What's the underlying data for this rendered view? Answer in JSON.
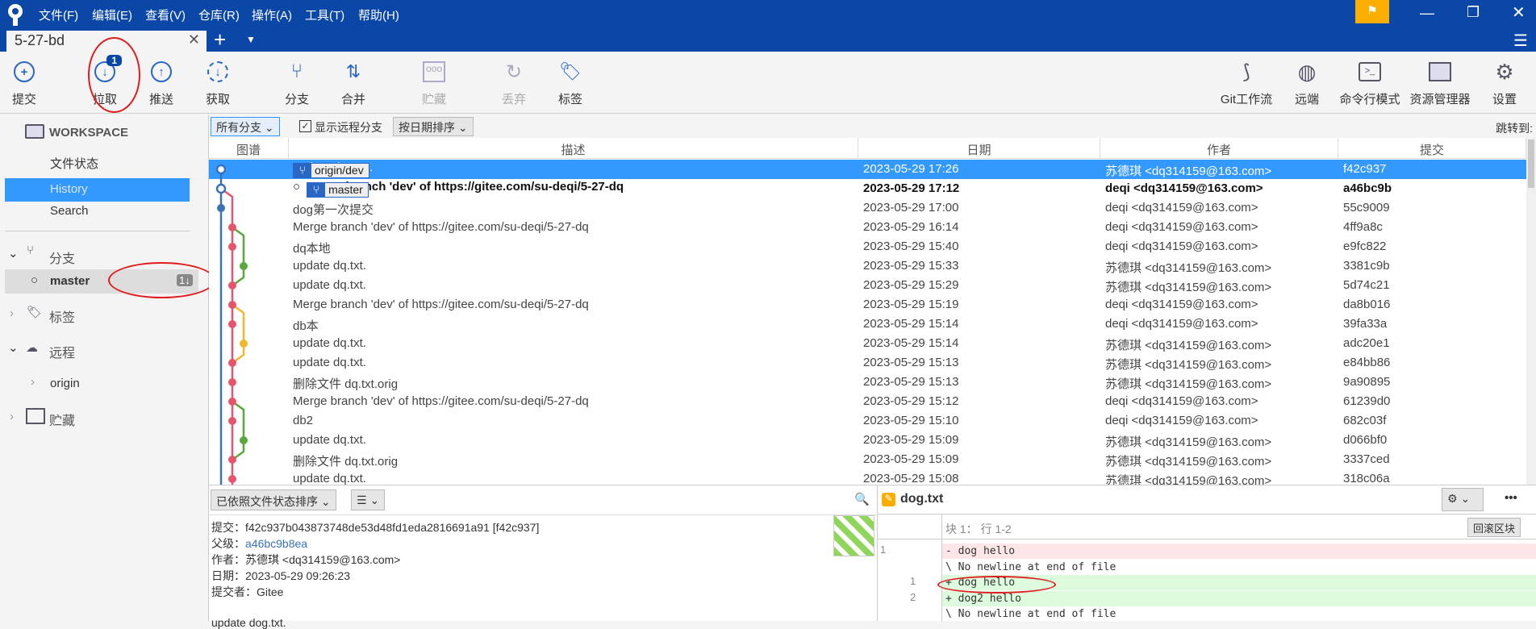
{
  "menu": [
    "文件(F)",
    "编辑(E)",
    "查看(V)",
    "仓库(R)",
    "操作(A)",
    "工具(T)",
    "帮助(H)"
  ],
  "tab": {
    "title": "5-27-bd"
  },
  "toolbar": {
    "left": [
      {
        "label": "提交",
        "icon": "plus-circle-icon"
      },
      {
        "label": "拉取",
        "icon": "pull-icon",
        "badge": "1"
      },
      {
        "label": "推送",
        "icon": "push-icon"
      },
      {
        "label": "获取",
        "icon": "fetch-icon"
      },
      {
        "label": "分支",
        "icon": "branch-icon"
      },
      {
        "label": "合并",
        "icon": "merge-icon"
      },
      {
        "label": "贮藏",
        "icon": "stash-icon",
        "disabled": true
      },
      {
        "label": "丢弃",
        "icon": "discard-icon",
        "disabled": true
      },
      {
        "label": "标签",
        "icon": "tag-icon"
      }
    ],
    "right": [
      {
        "label": "Git工作流",
        "icon": "git-flow-icon"
      },
      {
        "label": "远端",
        "icon": "globe-icon"
      },
      {
        "label": "命令行模式",
        "icon": "terminal-icon"
      },
      {
        "label": "资源管理器",
        "icon": "folder-icon"
      },
      {
        "label": "设置",
        "icon": "gear-icon"
      }
    ]
  },
  "sidebar": {
    "workspace": "WORKSPACE",
    "file_status": "文件状态",
    "history": "History",
    "search": "Search",
    "branches": "分支",
    "master": "master",
    "master_badge": "1↓",
    "tags": "标签",
    "remotes": "远程",
    "origin": "origin",
    "stashes": "贮藏"
  },
  "filter": {
    "branches": "所有分支",
    "show_remote": "显示远程分支",
    "sort": "按日期排序",
    "jump": "跳转到:"
  },
  "columns": [
    "图谱",
    "描述",
    "日期",
    "作者",
    "提交"
  ],
  "commits": [
    {
      "ref": "origin/dev",
      "desc": "update dog.txt.",
      "date": "2023-05-29 17:26",
      "author": "苏德琪 <dq314159@163.com>",
      "hash": "f42c937"
    },
    {
      "ref": "master",
      "desc": "Merge branch 'dev' of https://gitee.com/su-deqi/5-27-dq",
      "date": "2023-05-29 17:12",
      "author": "deqi <dq314159@163.com>",
      "hash": "a46bc9b"
    },
    {
      "desc": "dog第一次提交",
      "date": "2023-05-29 17:00",
      "author": "deqi <dq314159@163.com>",
      "hash": "55c9009"
    },
    {
      "desc": "Merge branch 'dev' of https://gitee.com/su-deqi/5-27-dq",
      "date": "2023-05-29 16:14",
      "author": "deqi <dq314159@163.com>",
      "hash": "4ff9a8c"
    },
    {
      "desc": "dq本地",
      "date": "2023-05-29 15:40",
      "author": "deqi <dq314159@163.com>",
      "hash": "e9fc822"
    },
    {
      "desc": "update dq.txt.",
      "date": "2023-05-29 15:33",
      "author": "苏德琪 <dq314159@163.com>",
      "hash": "3381c9b"
    },
    {
      "desc": "update dq.txt.",
      "date": "2023-05-29 15:29",
      "author": "苏德琪 <dq314159@163.com>",
      "hash": "5d74c21"
    },
    {
      "desc": "Merge branch 'dev' of https://gitee.com/su-deqi/5-27-dq",
      "date": "2023-05-29 15:19",
      "author": "deqi <dq314159@163.com>",
      "hash": "da8b016"
    },
    {
      "desc": "db本",
      "date": "2023-05-29 15:14",
      "author": "deqi <dq314159@163.com>",
      "hash": "39fa33a"
    },
    {
      "desc": "update dq.txt.",
      "date": "2023-05-29 15:14",
      "author": "苏德琪 <dq314159@163.com>",
      "hash": "adc20e1"
    },
    {
      "desc": "update dq.txt.",
      "date": "2023-05-29 15:13",
      "author": "苏德琪 <dq314159@163.com>",
      "hash": "e84bb86"
    },
    {
      "desc": "删除文件 dq.txt.orig",
      "date": "2023-05-29 15:13",
      "author": "苏德琪 <dq314159@163.com>",
      "hash": "9a90895"
    },
    {
      "desc": "Merge branch 'dev' of https://gitee.com/su-deqi/5-27-dq",
      "date": "2023-05-29 15:12",
      "author": "deqi <dq314159@163.com>",
      "hash": "61239d0"
    },
    {
      "desc": "db2",
      "date": "2023-05-29 15:10",
      "author": "deqi <dq314159@163.com>",
      "hash": "682c03f"
    },
    {
      "desc": "update dq.txt.",
      "date": "2023-05-29 15:09",
      "author": "苏德琪 <dq314159@163.com>",
      "hash": "d066bf0"
    },
    {
      "desc": "删除文件 dq.txt.orig",
      "date": "2023-05-29 15:09",
      "author": "苏德琪 <dq314159@163.com>",
      "hash": "3337ced"
    },
    {
      "desc": "update dq.txt.",
      "date": "2023-05-29 15:08",
      "author": "苏德琪 <dq314159@163.com>",
      "hash": "318c06a"
    }
  ],
  "graph_colors": {
    "main": "#3a72b8",
    "dev": "#e8546e",
    "side1": "#5aa83c",
    "side2": "#f3b72c",
    "selected": "#3399ff"
  },
  "details": {
    "sort": "已依照文件状态排序",
    "commit_label": "提交：",
    "commit": "f42c937b043873748de53d48fd1eda2816691a91 [f42c937]",
    "parent_label": "父级：",
    "parent": "a46bc9b8ea",
    "author_label": "作者：",
    "author": "苏德琪 <dq314159@163.com>",
    "date_label": "日期：",
    "date": "2023-05-29 09:26:23",
    "committer_label": "提交者：",
    "committer": "Gitee",
    "message": "update dog.txt."
  },
  "diff": {
    "file": "dog.txt",
    "hunk": "块 1： 行 1-2",
    "revert": "回滚区块",
    "lines": [
      {
        "old": "1",
        "new": "",
        "text": "- dog hello",
        "type": "del"
      },
      {
        "old": "",
        "new": "",
        "text": "\\  No newline at end of file",
        "type": "ctx"
      },
      {
        "old": "",
        "new": "1",
        "text": "+ dog hello",
        "type": "add"
      },
      {
        "old": "",
        "new": "2",
        "text": "+ dog2 hello",
        "type": "add"
      },
      {
        "old": "",
        "new": "",
        "text": "\\  No newline at end of file",
        "type": "ctx"
      }
    ]
  }
}
